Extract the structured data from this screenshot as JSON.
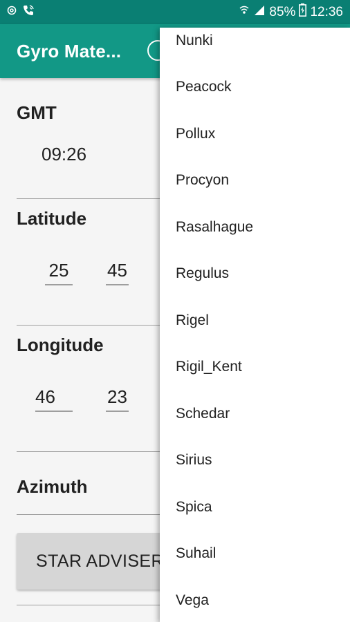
{
  "status_bar": {
    "battery": "85%",
    "time": "12:36"
  },
  "app_bar": {
    "title": "Gyro Mate..."
  },
  "form": {
    "gmt_label": "GMT",
    "gmt_value": "09:26",
    "latitude_label": "Latitude",
    "latitude_deg": "25",
    "latitude_min": "45",
    "longitude_label": "Longitude",
    "longitude_deg": "46",
    "longitude_min": "23",
    "azimuth_label": "Azimuth",
    "star_adviser_label": "STAR ADVISER"
  },
  "menu": {
    "items": [
      "Nunki",
      "Peacock",
      "Pollux",
      "Procyon",
      "Rasalhague",
      "Regulus",
      "Rigel",
      "Rigil_Kent",
      "Schedar",
      "Sirius",
      "Spica",
      "Suhail",
      "Vega"
    ]
  }
}
